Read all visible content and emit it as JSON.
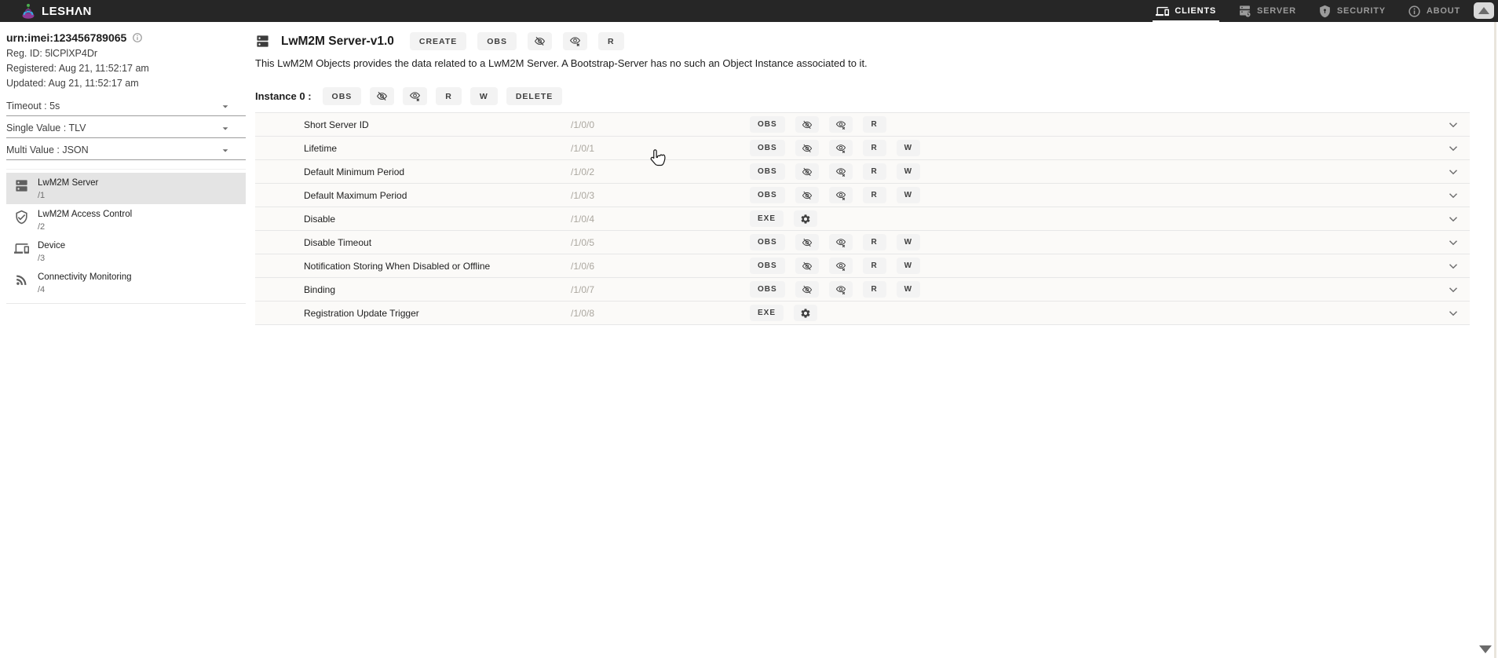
{
  "topbar": {
    "brand": "LESHΛN",
    "nav": [
      {
        "label": "CLIENTS",
        "icon": "devices-icon",
        "active": true
      },
      {
        "label": "SERVER",
        "icon": "server-icon",
        "active": false
      },
      {
        "label": "SECURITY",
        "icon": "shield-icon",
        "active": false
      },
      {
        "label": "ABOUT",
        "icon": "info-icon",
        "active": false
      }
    ]
  },
  "sidebar": {
    "endpoint": "urn:imei:123456789065",
    "reg_id": "Reg. ID: 5lCPlXP4Dr",
    "registered": "Registered: Aug 21, 11:52:17 am",
    "updated": "Updated: Aug 21, 11:52:17 am",
    "settings": [
      "Timeout : 5s",
      "Single Value : TLV",
      "Multi Value : JSON"
    ],
    "objects": [
      {
        "label": "LwM2M Server",
        "path": "/1",
        "icon": "dns-icon",
        "selected": true
      },
      {
        "label": "LwM2M Access Control",
        "path": "/2",
        "icon": "shield-check-icon",
        "selected": false
      },
      {
        "label": "Device",
        "path": "/3",
        "icon": "devices-icon",
        "selected": false
      },
      {
        "label": "Connectivity Monitoring",
        "path": "/4",
        "icon": "rss-icon",
        "selected": false
      }
    ]
  },
  "main": {
    "title": "LwM2M Server-v1.0",
    "title_buttons": [
      "CREATE",
      "OBS",
      "eye-off",
      "eye-x",
      "R"
    ],
    "description": "This LwM2M Objects provides the data related to a LwM2M Server. A Bootstrap-Server has no such an Object Instance associated to it.",
    "instance_label": "Instance 0 :",
    "instance_buttons": [
      "OBS",
      "eye-off",
      "eye-x",
      "R",
      "W",
      "DELETE"
    ],
    "resources": [
      {
        "name": "Short Server ID",
        "path": "/1/0/0",
        "buttons": [
          "OBS",
          "eye-off",
          "eye-x",
          "R"
        ]
      },
      {
        "name": "Lifetime",
        "path": "/1/0/1",
        "buttons": [
          "OBS",
          "eye-off",
          "eye-x",
          "R",
          "W"
        ]
      },
      {
        "name": "Default Minimum Period",
        "path": "/1/0/2",
        "buttons": [
          "OBS",
          "eye-off",
          "eye-x",
          "R",
          "W"
        ]
      },
      {
        "name": "Default Maximum Period",
        "path": "/1/0/3",
        "buttons": [
          "OBS",
          "eye-off",
          "eye-x",
          "R",
          "W"
        ]
      },
      {
        "name": "Disable",
        "path": "/1/0/4",
        "buttons": [
          "EXE",
          "gear"
        ]
      },
      {
        "name": "Disable Timeout",
        "path": "/1/0/5",
        "buttons": [
          "OBS",
          "eye-off",
          "eye-x",
          "R",
          "W"
        ]
      },
      {
        "name": "Notification Storing When Disabled or Offline",
        "path": "/1/0/6",
        "buttons": [
          "OBS",
          "eye-off",
          "eye-x",
          "R",
          "W"
        ]
      },
      {
        "name": "Binding",
        "path": "/1/0/7",
        "buttons": [
          "OBS",
          "eye-off",
          "eye-x",
          "R",
          "W"
        ]
      },
      {
        "name": "Registration Update Trigger",
        "path": "/1/0/8",
        "buttons": [
          "EXE",
          "gear"
        ]
      }
    ]
  },
  "colors": {
    "topbar_bg": "#262626",
    "nav_inactive": "#9b9b9b",
    "nav_active": "#ffffff",
    "chip_bg": "#f3f3f3",
    "row_bg": "#fbfaf8",
    "row_border": "#e7e7e7",
    "path_text": "#aba79f",
    "selected_item_bg": "#e4e4e4",
    "logo_purple": "#8e3a96",
    "logo_blue": "#3aa6dd",
    "logo_green": "#4caf50"
  }
}
